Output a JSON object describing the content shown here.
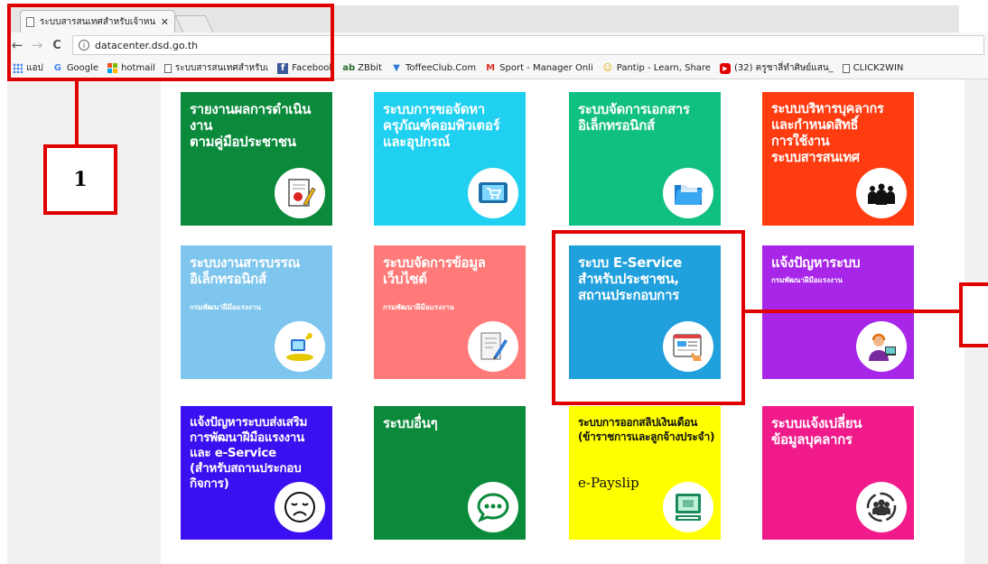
{
  "browser": {
    "tab_title": "ระบบสารสนเทศสำหรับเจ้าหน",
    "tab_close": "✕",
    "nav": {
      "back": "←",
      "forward": "→",
      "reload": "C"
    },
    "url": "datacenter.dsd.go.th",
    "bookmarks": [
      {
        "label": "แอป",
        "icon": "apps-icon"
      },
      {
        "label": "Google",
        "icon": "google-icon",
        "color": "#4285f4",
        "glyph": "G"
      },
      {
        "label": "hotmail",
        "icon": "microsoft-icon"
      },
      {
        "label": "ระบบสารสนเทศสำหรับเ",
        "icon": "page-icon"
      },
      {
        "label": "Facebook",
        "icon": "facebook-icon",
        "color": "#3b5998",
        "glyph": "f"
      },
      {
        "label": "ZBbit",
        "icon": "zbbit-icon",
        "color": "#2a6a2a",
        "glyph": "ab"
      },
      {
        "label": "ToffeeClub.Com",
        "icon": "toffeeclub-icon",
        "color": "#2f7bd6",
        "glyph": "▼"
      },
      {
        "label": "Sport - Manager Onli",
        "icon": "gmail-icon",
        "color": "#d93025",
        "glyph": "M"
      },
      {
        "label": "Pantip - Learn, Share",
        "icon": "pantip-icon",
        "color": "#e0a800",
        "glyph": "☺"
      },
      {
        "label": "(32) ครูชาลี่ทำศิษย์แสน_",
        "icon": "youtube-icon",
        "color": "#e00000",
        "glyph": "▶"
      },
      {
        "label": "CLICK2WIN",
        "icon": "page-icon"
      }
    ]
  },
  "tiles": [
    {
      "title": "รายงานผลการดำเนินงาน\nตามคู่มือประชาชน",
      "color": "#0b8a3b",
      "icon": "report-icon"
    },
    {
      "title": "ระบบการขอจัดหา\nครุภัณฑ์คอมพิวเตอร์\nและอุปกรณ์",
      "color": "#1fd0f0",
      "icon": "shopping-cart-monitor-icon"
    },
    {
      "title": "ระบบจัดการเอกสาร\nอิเล็กทรอนิกส์",
      "color": "#10c080",
      "icon": "folder-icon"
    },
    {
      "title": "ระบบบริหารบุคลากร\nและกำหนดสิทธิ์\nการใช้งาน\nระบบสารสนเทศ",
      "color": "#ff3b10",
      "icon": "people-group-icon"
    },
    {
      "title": "ระบบงานสารบรรณ\nอิเล็กทรอนิกส์",
      "subtitle": "กรมพัฒนาฝีมือแรงงาน",
      "color": "#7ec6ee",
      "icon": "trophy-icon"
    },
    {
      "title": "ระบบจัดการข้อมูล\nเว็บไซต์",
      "subtitle": "กรมพัฒนาฝีมือแรงงาน",
      "color": "#ff7a78",
      "icon": "document-pen-icon"
    },
    {
      "title": "ระบบ E-Service\nสำหรับประชาชน,\nสถานประกอบการ",
      "color": "#20a0dc",
      "icon": "web-browser-hand-icon"
    },
    {
      "title": "แจ้งปัญหาระบบ",
      "subtitle": "กรมพัฒนาฝีมือแรงงาน",
      "color": "#a826e8",
      "icon": "support-agent-icon"
    },
    {
      "title": "แจ้งปัญหาระบบส่งเสริม\nการพัฒนาฝีมือแรงงาน\nและ e-Service\n(สำหรับสถานประกอบกิจการ)",
      "color": "#3a10f0",
      "icon": "sad-face-icon"
    },
    {
      "title": "ระบบอื่นๆ",
      "color": "#0b8a3b",
      "icon": "chat-bubble-icon"
    },
    {
      "title": "ระบบการออกสลิปเงินเดือน\n(ข้าราชการและลูกจ้างประจำ)",
      "extra": "e-Payslip",
      "color": "#ffff00",
      "icon": "e-statement-icon"
    },
    {
      "title": "ระบบแจ้งเปลี่ยน\nข้อมูลบุคลากร",
      "color": "#f01a8a",
      "icon": "people-cycle-icon"
    }
  ],
  "annotations": {
    "callout_1": "1"
  }
}
